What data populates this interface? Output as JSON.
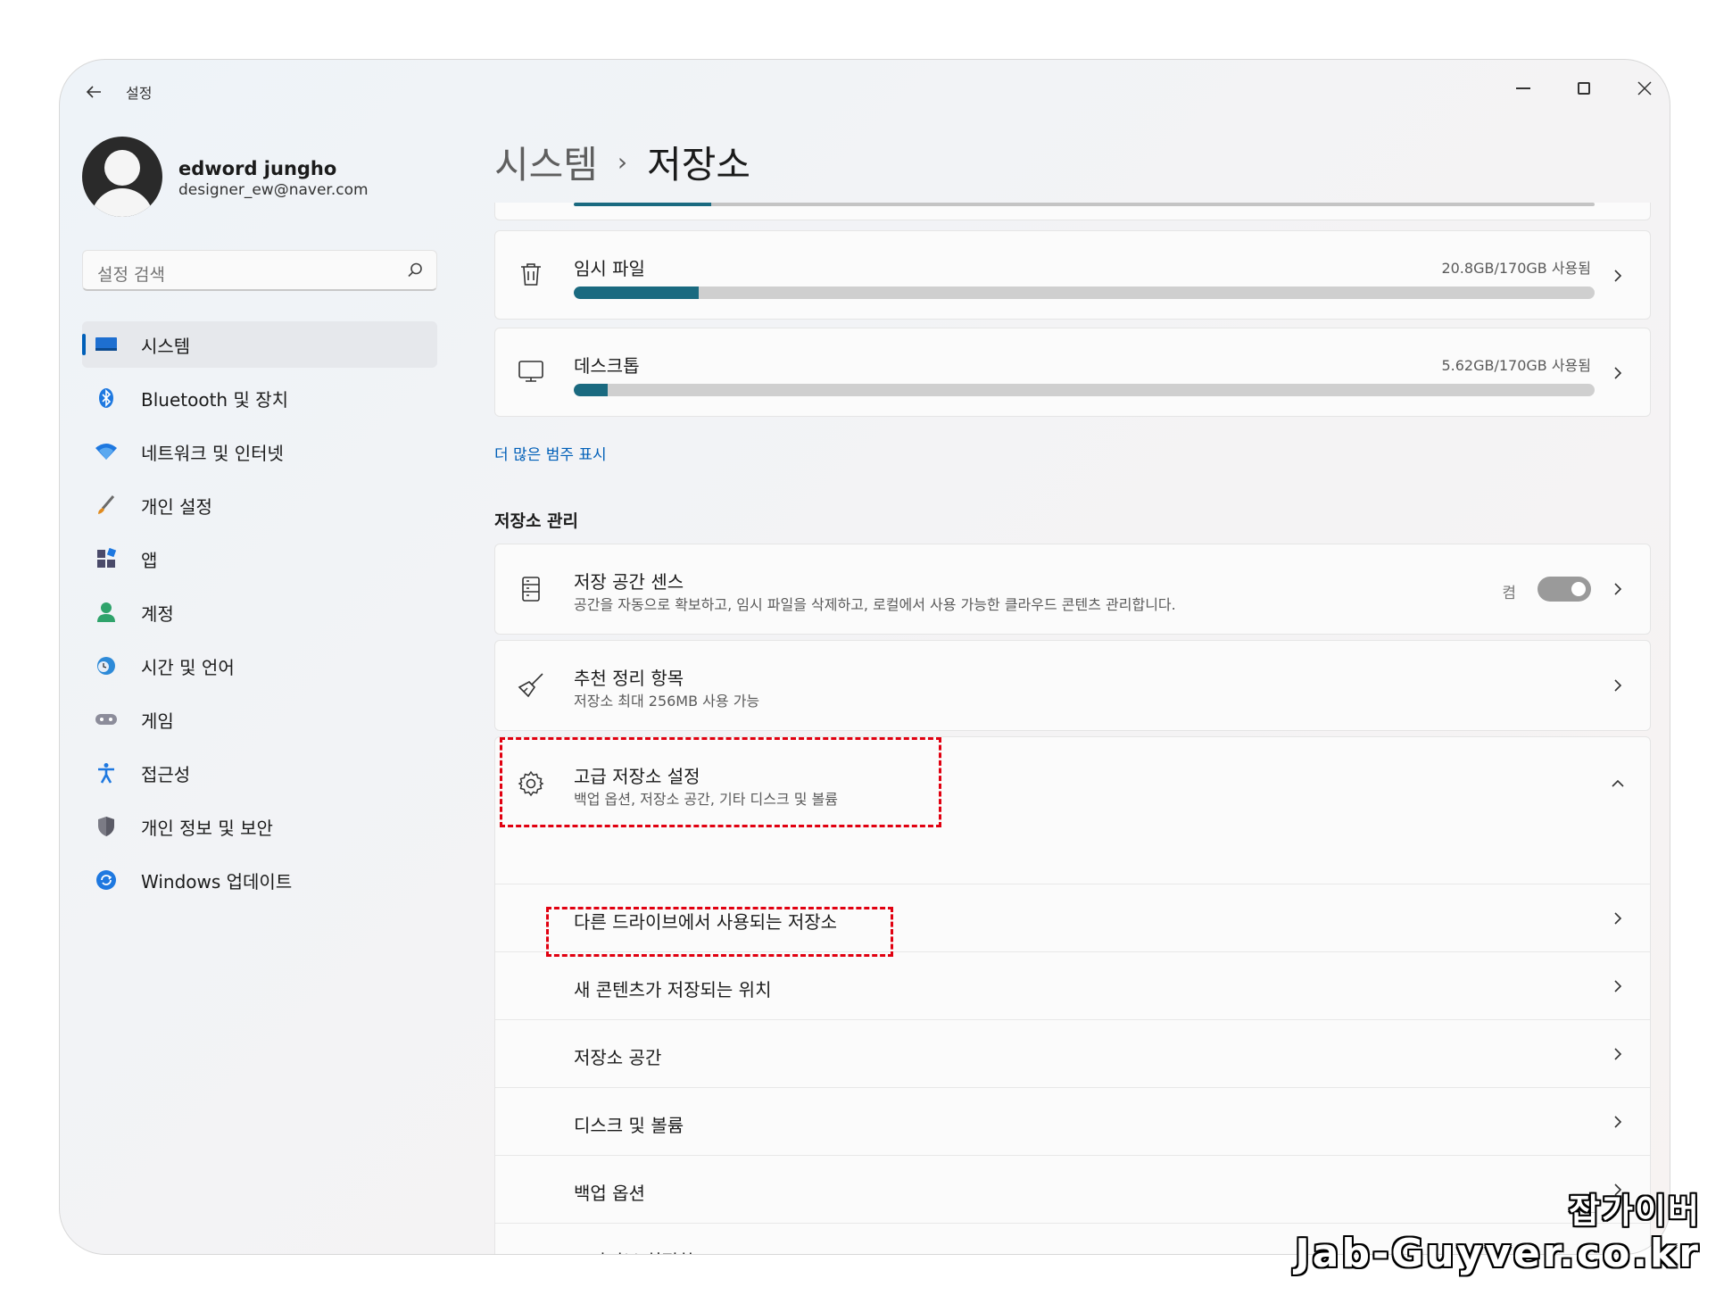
{
  "titlebar": {
    "app_title": "설정"
  },
  "profile": {
    "name": "edword jungho",
    "email": "designer_ew@naver.com"
  },
  "search": {
    "placeholder": "설정 검색"
  },
  "nav": {
    "items": [
      {
        "label": "시스템",
        "icon": "monitor-icon",
        "active": true
      },
      {
        "label": "Bluetooth 및 장치",
        "icon": "bluetooth-icon"
      },
      {
        "label": "네트워크 및 인터넷",
        "icon": "wifi-icon"
      },
      {
        "label": "개인 설정",
        "icon": "brush-icon"
      },
      {
        "label": "앱",
        "icon": "apps-icon"
      },
      {
        "label": "계정",
        "icon": "person-icon"
      },
      {
        "label": "시간 및 언어",
        "icon": "clock-globe-icon"
      },
      {
        "label": "게임",
        "icon": "gamepad-icon"
      },
      {
        "label": "접근성",
        "icon": "accessibility-icon"
      },
      {
        "label": "개인 정보 및 보안",
        "icon": "shield-icon"
      },
      {
        "label": "Windows 업데이트",
        "icon": "refresh-icon"
      }
    ]
  },
  "breadcrumb": {
    "parent": "시스템",
    "separator": "›",
    "current": "저장소"
  },
  "storage": {
    "temp": {
      "title": "임시 파일",
      "usage": "20.8GB/170GB 사용됨",
      "fraction": 0.122
    },
    "desktop": {
      "title": "데스크톱",
      "usage": "5.62GB/170GB 사용됨",
      "fraction": 0.033
    },
    "top_bar_fraction": 0.135
  },
  "more_categories": "더 많은 범주 표시",
  "management": {
    "section_title": "저장소 관리",
    "storage_sense": {
      "title": "저장 공간 센스",
      "subtitle": "공간을 자동으로 확보하고, 임시 파일을 삭제하고, 로컬에서 사용 가능한 클라우드 콘텐츠 관리합니다.",
      "toggle_label": "켬",
      "toggle_on": false
    },
    "cleanup": {
      "title": "추천 정리 항목",
      "subtitle": "저장소 최대 256MB 사용 가능"
    },
    "advanced": {
      "title": "고급 저장소 설정",
      "subtitle": "백업 옵션, 저장소 공간, 기타 디스크 및 볼륨",
      "items": [
        "다른 드라이브에서 사용되는 저장소",
        "새 콘텐츠가 저장되는 위치",
        "저장소 공간",
        "디스크 및 볼륨",
        "백업 옵션",
        "드라이브 최적화"
      ]
    }
  },
  "colors": {
    "accent": "#005fb8",
    "bar_fill": "#1a6a80",
    "highlight": "#e10010"
  },
  "watermark": {
    "line1": "잡가이버",
    "line2": "Jab-Guyver.co.kr"
  }
}
